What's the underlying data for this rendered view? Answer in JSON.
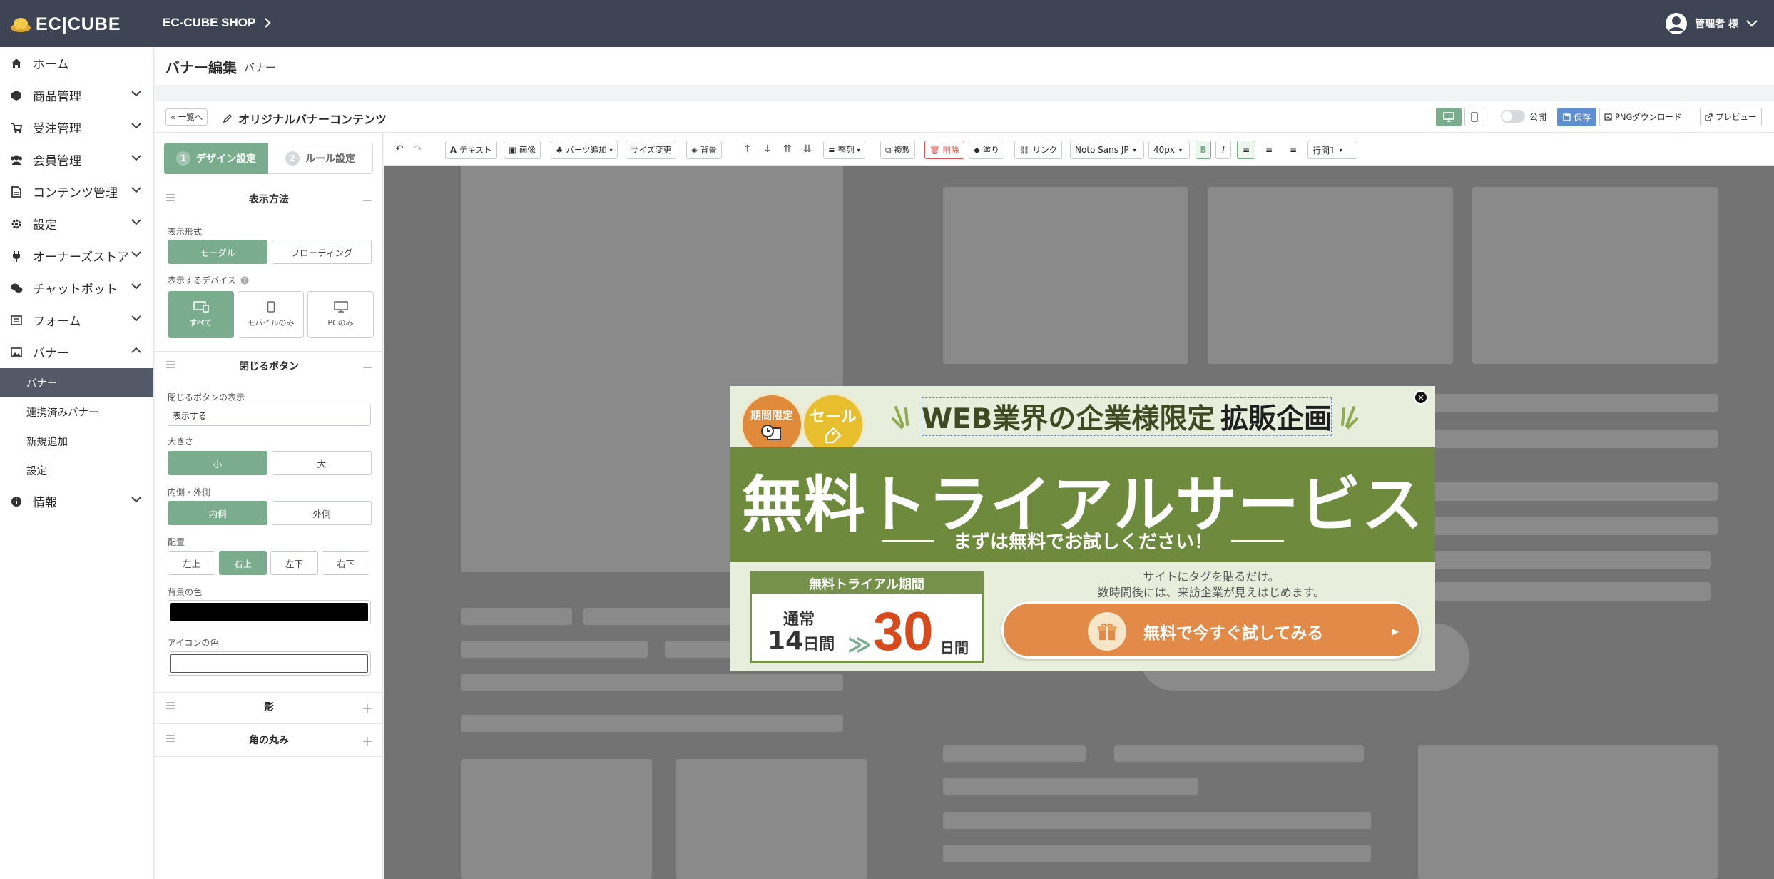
{
  "header": {
    "logo_text": "EC|CUBE",
    "shop_name": "EC-CUBE SHOP",
    "user_name": "管理者 様"
  },
  "sidebar": {
    "items": [
      {
        "label": "ホーム",
        "icon": "home-icon"
      },
      {
        "label": "商品管理",
        "icon": "cube-icon"
      },
      {
        "label": "受注管理",
        "icon": "cart-icon"
      },
      {
        "label": "会員管理",
        "icon": "users-icon"
      },
      {
        "label": "コンテンツ管理",
        "icon": "file-icon"
      },
      {
        "label": "設定",
        "icon": "gear-icon"
      },
      {
        "label": "オーナーズストア",
        "icon": "plug-icon"
      },
      {
        "label": "チャットボット",
        "icon": "chat-icon"
      },
      {
        "label": "フォーム",
        "icon": "list-icon"
      },
      {
        "label": "バナー",
        "icon": "image-icon"
      }
    ],
    "banner_sub": [
      "バナー",
      "連携済みバナー",
      "新規追加",
      "設定"
    ],
    "info": "情報"
  },
  "page": {
    "title": "バナー編集",
    "subtitle": "バナー"
  },
  "editor": {
    "back_label": "一覧へ",
    "title": "オリジナルバナーコンテンツ",
    "publish_label": "公開",
    "save_label": "保存",
    "png_label": "PNGダウンロード",
    "preview_label": "プレビュー"
  },
  "panel": {
    "step1": "デザイン設定",
    "step2": "ルール設定",
    "step1_num": "1",
    "step2_num": "2",
    "display_section": "表示方法",
    "display_format_label": "表示形式",
    "format_modal": "モーダル",
    "format_floating": "フローティング",
    "device_label": "表示するデバイス",
    "device_all": "すべて",
    "device_mobile": "モバイルのみ",
    "device_pc": "PCのみ",
    "close_section": "閉じるボタン",
    "close_display_label": "閉じるボタンの表示",
    "close_display_value": "表示する",
    "size_label": "大きさ",
    "size_small": "小",
    "size_large": "大",
    "inout_label": "内側・外側",
    "inside": "内側",
    "outside": "外側",
    "position_label": "配置",
    "pos_tl": "左上",
    "pos_tr": "右上",
    "pos_bl": "左下",
    "pos_br": "右下",
    "bg_color_label": "背景の色",
    "bg_color": "#000000",
    "icon_color_label": "アイコンの色",
    "icon_color": "#ffffff",
    "shadow_section": "影",
    "radius_section": "角の丸み",
    "minus": "－",
    "plus": "＋"
  },
  "toolbar": {
    "text": "テキスト",
    "image": "画像",
    "add_parts": "パーツ追加",
    "resize": "サイズ変更",
    "background": "背景",
    "align": "整列",
    "duplicate": "複製",
    "delete": "削除",
    "fill": "塗り",
    "link": "リンク",
    "font": "Noto Sans JP",
    "font_size": "40px",
    "bold": "B",
    "italic": "I",
    "line_height": "行間1"
  },
  "banner": {
    "badge1": "期間限定",
    "badge2": "セール",
    "headline_a": "WEB業界の企業様限定",
    "headline_b": "拡販企画",
    "main": "無料トライアルサービス",
    "subline": "まずは無料でお試しください！",
    "trial_head": "無料トライアル期間",
    "normal_label": "通常",
    "normal_days": "14",
    "day_unit": "日間",
    "arrows": "≫",
    "trial_days": "30",
    "copy1": "サイトにタグを貼るだけ。",
    "copy2": "数時間後には、来訪企業が見えはじめます。",
    "cta": "無料で今すぐ試してみる",
    "close": "×",
    "colors": {
      "green": "#6e8b3d",
      "orange": "#e28a47",
      "red": "#d64a1c",
      "cream": "#e7eedb"
    }
  },
  "colors": {
    "accent": "#79ad8e",
    "topbar": "#3d4554",
    "save": "#5d8fd1"
  }
}
